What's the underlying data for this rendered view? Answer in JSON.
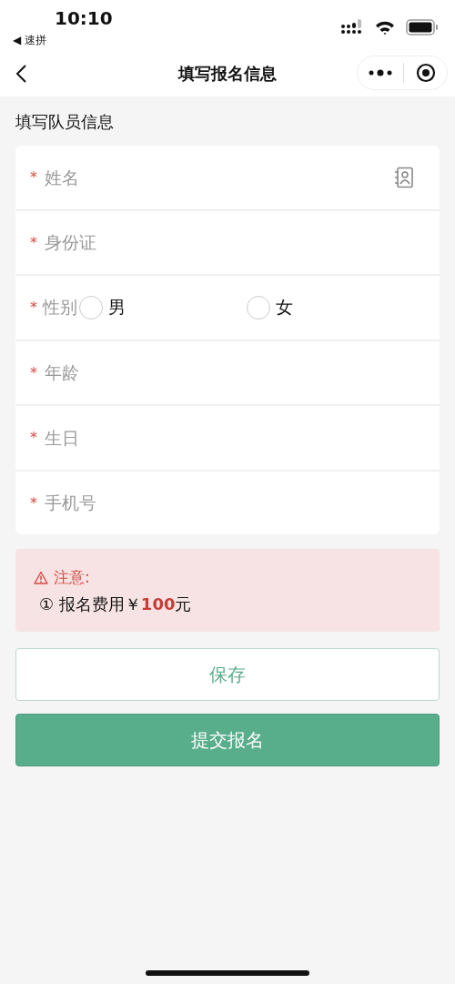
{
  "status_bar": {
    "time": "10:10",
    "back_app": "◀ 速拼"
  },
  "nav": {
    "title": "填写报名信息"
  },
  "section_title": "填写队员信息",
  "fields": [
    {
      "kind": "text",
      "required_mark": "*",
      "placeholder": "姓名",
      "contact_icon": true
    },
    {
      "kind": "text",
      "required_mark": "*",
      "placeholder": "身份证",
      "contact_icon": false
    },
    {
      "kind": "radio",
      "required_mark": "*",
      "label": "性别",
      "options": [
        {
          "label": "男",
          "selected": false
        },
        {
          "label": "女",
          "selected": false
        }
      ]
    },
    {
      "kind": "text",
      "required_mark": "*",
      "placeholder": "年龄",
      "contact_icon": false
    },
    {
      "kind": "text",
      "required_mark": "*",
      "placeholder": "生日",
      "contact_icon": false
    },
    {
      "kind": "text",
      "required_mark": "*",
      "placeholder": "手机号",
      "contact_icon": false
    }
  ],
  "notice": {
    "title": "注意:",
    "items": [
      {
        "prefix": "① 报名费用￥",
        "amount": "100",
        "suffix": "元"
      }
    ]
  },
  "buttons": [
    {
      "kind": "outline",
      "label": "保存"
    },
    {
      "kind": "primary",
      "label": "提交报名"
    }
  ]
}
